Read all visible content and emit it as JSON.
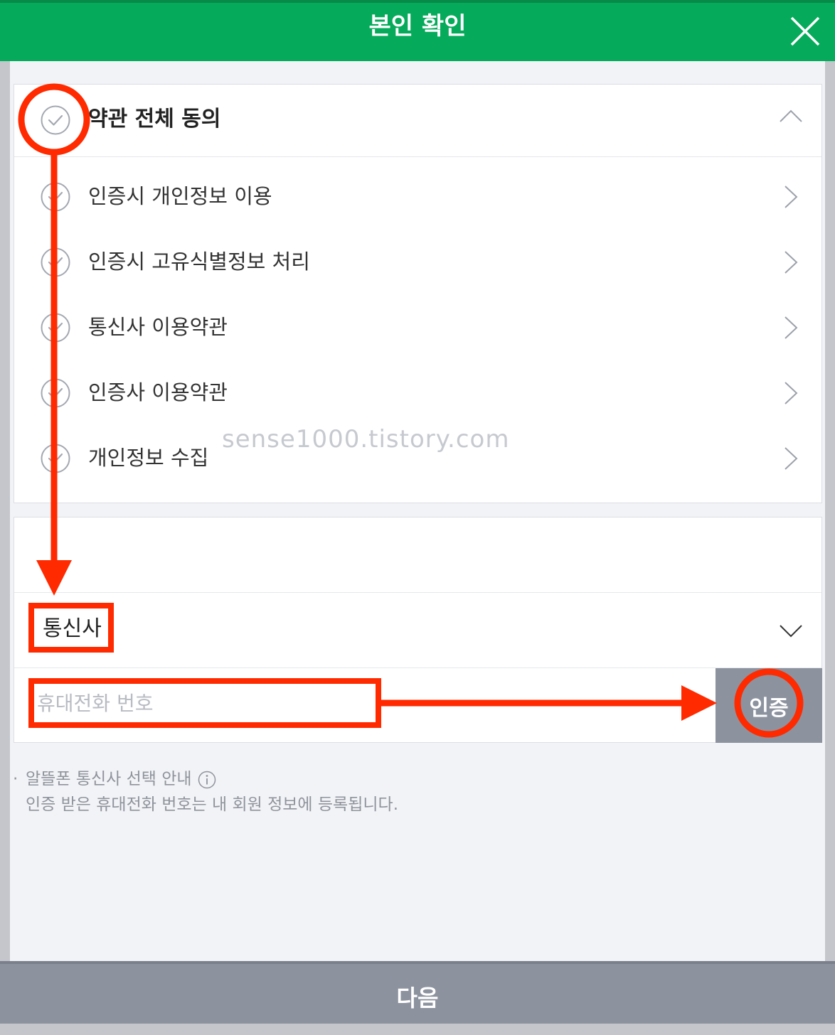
{
  "header": {
    "title": "본인 확인",
    "close_icon": "close-icon"
  },
  "terms": {
    "all_label": "약관 전체 동의",
    "items": [
      {
        "label": "인증시 개인정보 이용"
      },
      {
        "label": "인증시 고유식별정보 처리"
      },
      {
        "label": "통신사 이용약관"
      },
      {
        "label": "인증사 이용약관"
      },
      {
        "label": "개인정보 수집"
      }
    ]
  },
  "watermark": "sense1000.tistory.com",
  "auth": {
    "carrier_label": "통신사",
    "phone_placeholder": "휴대전화 번호",
    "verify_label": "인증"
  },
  "notes": {
    "bullet": "·",
    "line1": "알뜰폰 통신사 선택 안내",
    "line2": "인증 받은 휴대전화 번호는 내 회원 정보에 등록됩니다."
  },
  "footer": {
    "next_label": "다음"
  },
  "colors": {
    "brand_green": "#05aa5a",
    "annotation_red": "#ff2a00",
    "button_gray": "#8c939f"
  }
}
